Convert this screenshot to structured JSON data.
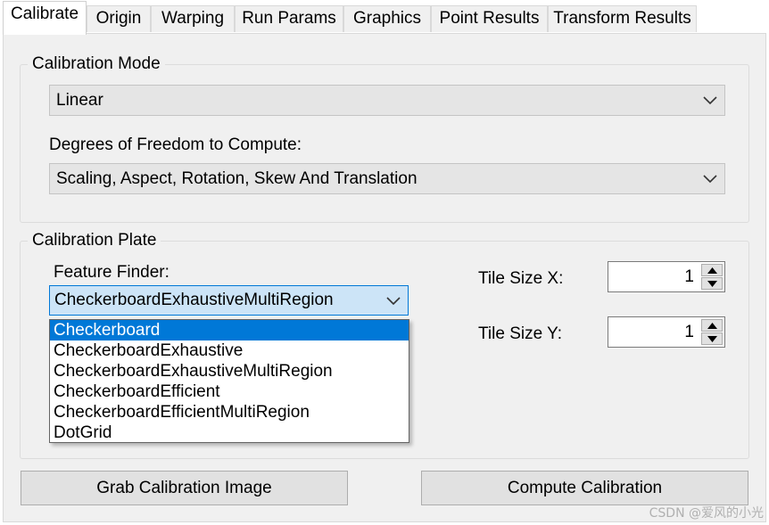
{
  "tabs": [
    {
      "label": "Calibrate",
      "active": true
    },
    {
      "label": "Origin"
    },
    {
      "label": "Warping"
    },
    {
      "label": "Run Params"
    },
    {
      "label": "Graphics"
    },
    {
      "label": "Point Results"
    },
    {
      "label": "Transform Results"
    }
  ],
  "calibration_mode": {
    "group_title": "Calibration Mode",
    "mode_value": "Linear",
    "dof_label": "Degrees of Freedom to Compute:",
    "dof_value": "Scaling, Aspect, Rotation, Skew And Translation"
  },
  "calibration_plate": {
    "group_title": "Calibration Plate",
    "feature_finder_label": "Feature Finder:",
    "feature_finder_value": "CheckerboardExhaustiveMultiRegion",
    "feature_finder_options": [
      "Checkerboard",
      "CheckerboardExhaustive",
      "CheckerboardExhaustiveMultiRegion",
      "CheckerboardEfficient",
      "CheckerboardEfficientMultiRegion",
      "DotGrid"
    ],
    "highlighted_option": "Checkerboard",
    "tile_size_x_label": "Tile Size X:",
    "tile_size_x_value": "1",
    "tile_size_y_label": "Tile Size Y:",
    "tile_size_y_value": "1"
  },
  "buttons": {
    "grab_image": "Grab Calibration Image",
    "compute": "Compute Calibration"
  },
  "watermark": "CSDN @爱风的小光",
  "colors": {
    "highlight": "#0078d7",
    "combo_focus_bg": "#cce4f7",
    "panel_bg": "#f0f0f0"
  }
}
